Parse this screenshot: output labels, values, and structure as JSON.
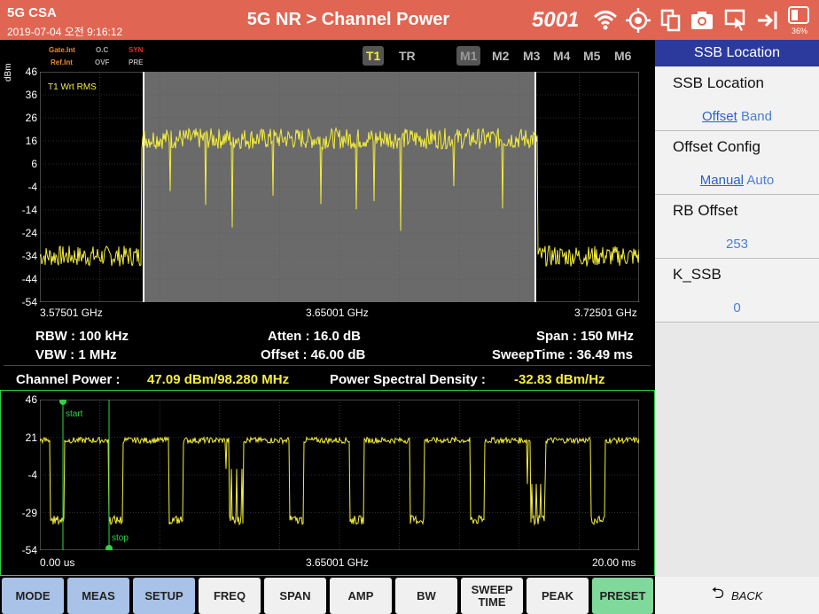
{
  "header": {
    "app_name": "5G CSA",
    "datetime": "2019-07-04 오전 9:16:12",
    "title": "5G NR > Channel Power",
    "counter": "5001",
    "battery_pct": "36%",
    "icons": [
      "wifi-icon",
      "gps-icon",
      "windows-icon",
      "camera-icon",
      "touch-screen-icon",
      "import-icon",
      "battery-icon"
    ]
  },
  "status": {
    "gate": "Gate.Int",
    "oc": "O.C",
    "syn": "SYN",
    "ref": "Ref.Int",
    "ovf": "OVF",
    "pre": "PRE",
    "colors": {
      "orange": "#f08a30",
      "red": "#e03030",
      "gray": "#aaaaaa"
    }
  },
  "tabs": [
    "T1",
    "TR",
    "M1",
    "M2",
    "M3",
    "M4",
    "M5",
    "M6"
  ],
  "trace": {
    "unit": "dBm",
    "mode_label": "T1 Wrt RMS",
    "y_ticks": [
      "46",
      "36",
      "26",
      "16",
      "6",
      "-4",
      "-14",
      "-24",
      "-34",
      "-44",
      "-54"
    ],
    "x_start": "3.57501 GHz",
    "x_center": "3.65001 GHz",
    "x_stop": "3.72501 GHz"
  },
  "info": {
    "rbw": "RBW : 100 kHz",
    "atten": "Atten : 16.0 dB",
    "span": "Span : 150 MHz",
    "vbw": "VBW : 1 MHz",
    "offset": "Offset : 46.00 dB",
    "sweeptime": "SweepTime : 36.49 ms",
    "channel_power_label": "Channel Power :",
    "channel_power_value": "47.09 dBm/98.280 MHz",
    "psd_label": "Power Spectral Density :",
    "psd_value": "-32.83 dBm/Hz"
  },
  "time_trace": {
    "y_ticks": [
      "46",
      "21",
      "-4",
      "-29",
      "-54"
    ],
    "start_label": "start",
    "stop_label": "stop",
    "x_start": "0.00 us",
    "x_center": "3.65001 GHz",
    "x_stop": "20.00 ms"
  },
  "buttons": [
    {
      "label": "MODE",
      "style": "blue"
    },
    {
      "label": "MEAS",
      "style": "blue"
    },
    {
      "label": "SETUP",
      "style": "blue"
    },
    {
      "label": "FREQ",
      "style": "white"
    },
    {
      "label": "SPAN",
      "style": "white"
    },
    {
      "label": "AMP",
      "style": "white"
    },
    {
      "label": "BW",
      "style": "white"
    },
    {
      "label": "SWEEP TIME",
      "style": "white"
    },
    {
      "label": "PEAK",
      "style": "white"
    },
    {
      "label": "PRESET",
      "style": "green"
    }
  ],
  "panel": {
    "title": "SSB Location",
    "items": [
      {
        "label": "SSB Location",
        "opt1": "Offset",
        "opt2": "Band"
      },
      {
        "label": "Offset Config",
        "opt1": "Manual",
        "opt2": "Auto"
      },
      {
        "label": "RB Offset",
        "value": "253"
      },
      {
        "label": "K_SSB",
        "value": "0"
      }
    ],
    "back_label": "BACK"
  }
}
